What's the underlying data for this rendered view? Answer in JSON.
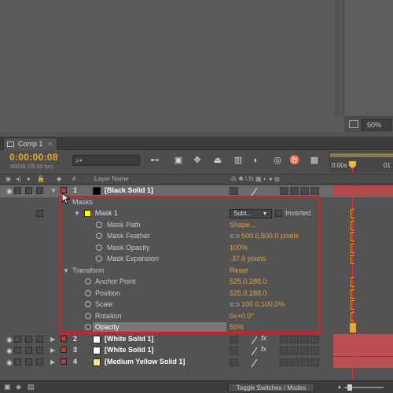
{
  "viewer": {
    "zoom": "50%"
  },
  "tab": {
    "label": "Comp 1"
  },
  "header": {
    "timecode": "0:00:00:08",
    "fps": "00008 (25.00 fps)",
    "search_icon": "search-icon"
  },
  "ruler": {
    "t0": "0:00s",
    "t1": "01"
  },
  "columns": {
    "num": "#",
    "layer_name": "Layer Name"
  },
  "layers": [
    {
      "num": "1",
      "name": "[Black Solid 1]",
      "color": "#000000"
    },
    {
      "num": "2",
      "name": "[White Solid 1]",
      "color": "#ffffff"
    },
    {
      "num": "3",
      "name": "[White Solid 1]",
      "color": "#ffffff"
    },
    {
      "num": "4",
      "name": "[Medium Yellow Solid 1]",
      "color": "#f3e48a"
    }
  ],
  "masks": {
    "group": "Masks",
    "mask1": {
      "name": "Mask 1",
      "mode": "Subt...",
      "inverted": "Inverted"
    },
    "props": [
      {
        "label": "Mask Path",
        "value": "Shape..."
      },
      {
        "label": "Mask Feather",
        "value": "500.0,500.0 pixels"
      },
      {
        "label": "Mask Opacity",
        "value": "100%"
      },
      {
        "label": "Mask Expansion",
        "value": "-37.0 pixels"
      }
    ]
  },
  "transform": {
    "group": "Transform",
    "reset": "Reset",
    "props": [
      {
        "label": "Anchor Point",
        "value": "525.0,288.0"
      },
      {
        "label": "Position",
        "value": "525.0,288.0"
      },
      {
        "label": "Scale",
        "value": "100.0,100.0%"
      },
      {
        "label": "Rotation",
        "value": "0x+0.0°"
      },
      {
        "label": "Opacity",
        "value": "50%"
      }
    ]
  },
  "bottom": {
    "toggle_label": "Toggle Switches / Modes"
  },
  "colors": {
    "accent_orange": "#e8a829",
    "highlight_red": "#d42020",
    "track_red": "#b5474b"
  }
}
